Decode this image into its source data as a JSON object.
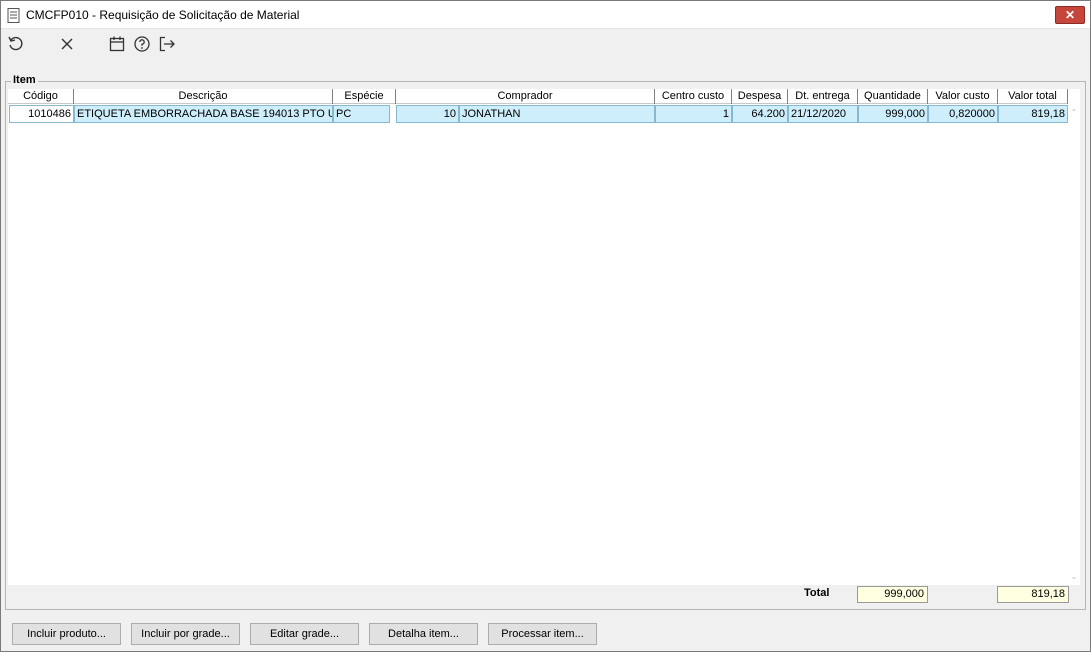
{
  "window": {
    "title": "CMCFP010 - Requisição de Solicitação de Material",
    "close_label": "✕"
  },
  "toolbar": {
    "icons": [
      "undo-icon",
      "close-icon",
      "calendar-icon",
      "help-icon",
      "exit-icon"
    ]
  },
  "group": {
    "legend": "Item"
  },
  "grid": {
    "columns": [
      "Código",
      "Descrição",
      "Espécie",
      "Comprador",
      "Centro custo",
      "Despesa",
      "Dt. entrega",
      "Quantidade",
      "Valor custo",
      "Valor total"
    ],
    "rows": [
      {
        "codigo": "1010486",
        "descricao": "ETIQUETA EMBORRACHADA BASE 194013 PTO U",
        "especie": "PC",
        "comprador_codigo": "10",
        "comprador_nome": "JONATHAN",
        "centro_custo": "1",
        "despesa": "64.200",
        "dt_entrega": "21/12/2020",
        "quantidade": "999,000",
        "valor_custo": "0,820000",
        "valor_total": "819,18"
      }
    ]
  },
  "totals": {
    "label": "Total",
    "quantidade": "999,000",
    "valor_total": "819,18"
  },
  "buttons": {
    "incluir_produto": "Incluir produto...",
    "incluir_grade": "Incluir por grade...",
    "editar_grade": "Editar grade...",
    "detalha_item": "Detalha item...",
    "processar_item": "Processar item..."
  },
  "colors": {
    "selected_row": "#cdeefa",
    "total_box": "#ffffe1",
    "close_button": "#c7463c"
  }
}
